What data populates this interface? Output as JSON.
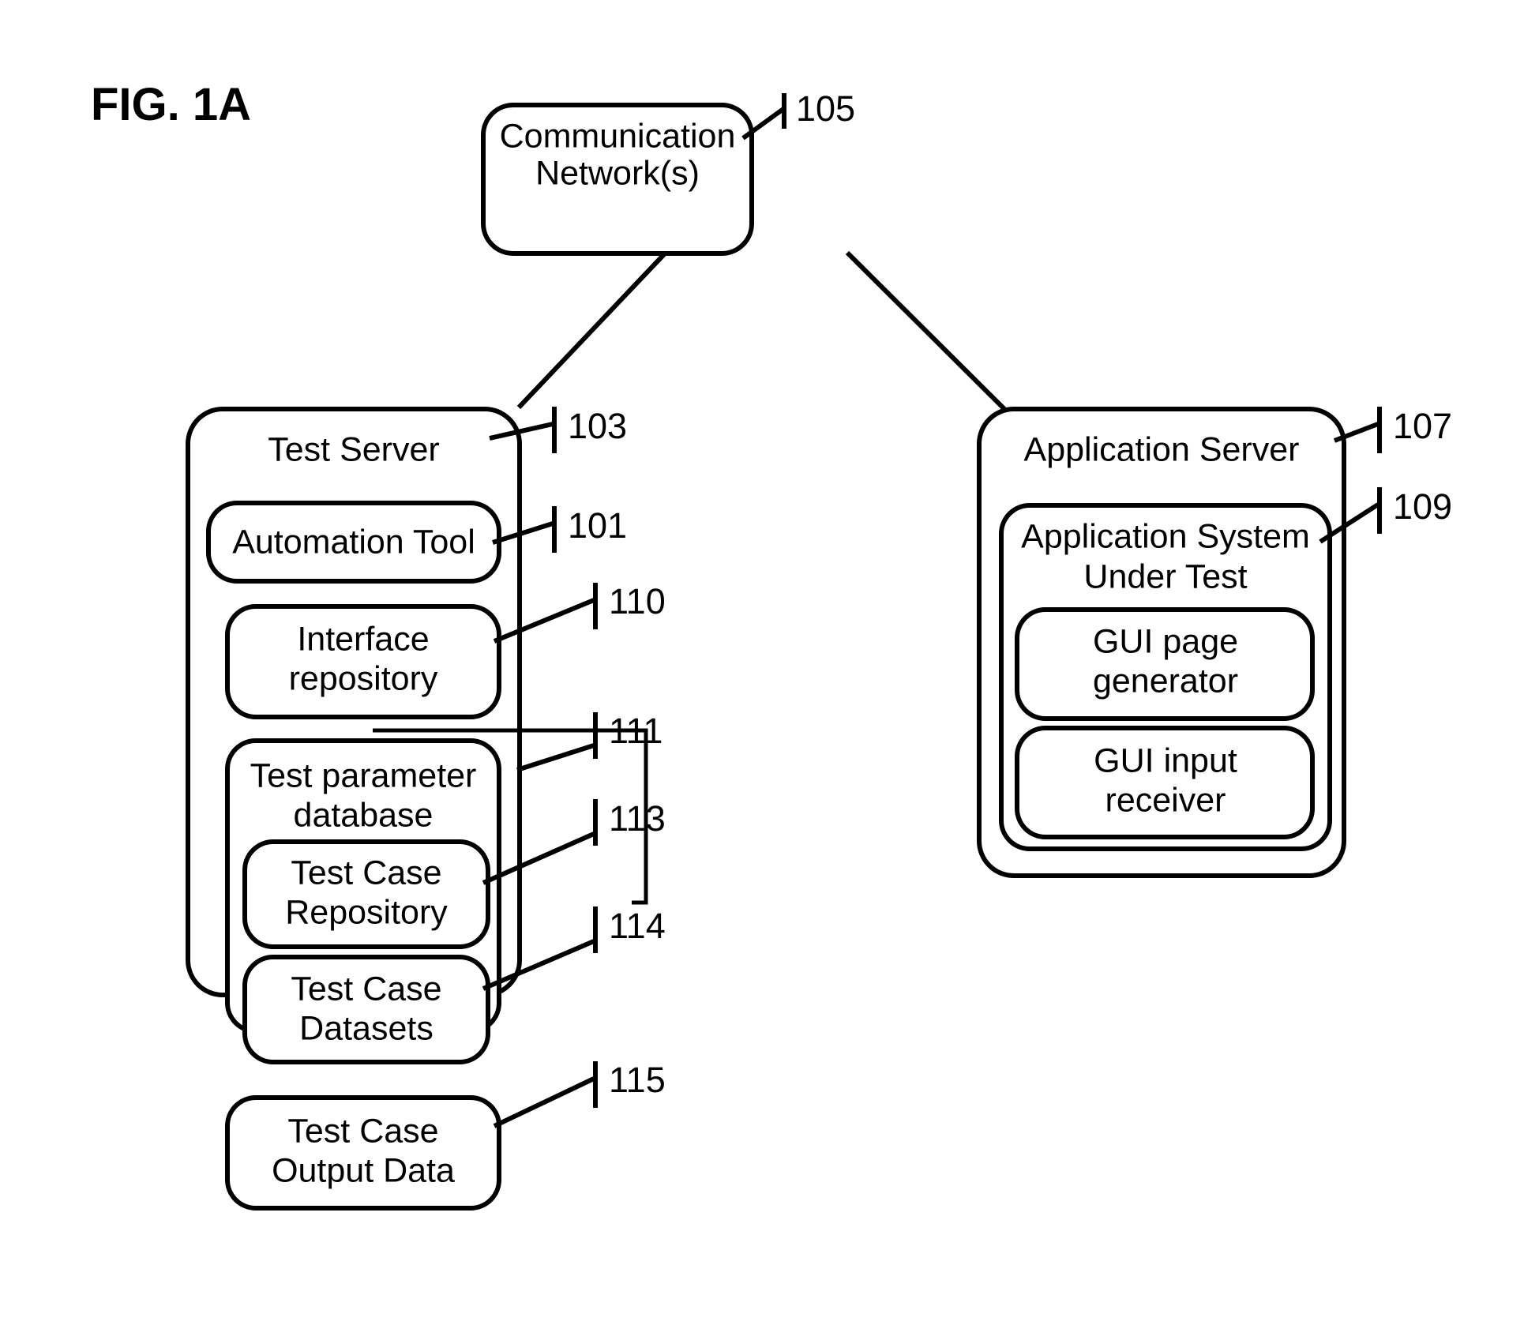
{
  "figure": {
    "title": "FIG. 1A",
    "line_color": "#000000",
    "background_color": "#ffffff"
  },
  "nodes": {
    "communication_network": {
      "label_line1": "Communication",
      "label_line2": "Network(s)",
      "ref": "105"
    },
    "test_server": {
      "label": "Test Server",
      "ref": "103"
    },
    "automation_tool": {
      "label": "Automation Tool",
      "ref": "101"
    },
    "interface_repository": {
      "label_line1": "Interface",
      "label_line2": "repository",
      "ref": "110"
    },
    "test_parameter_database": {
      "label_line1": "Test parameter",
      "label_line2": "database",
      "ref": "111"
    },
    "test_case_repository": {
      "label_line1": "Test Case",
      "label_line2": "Repository",
      "ref": "113"
    },
    "test_case_datasets": {
      "label_line1": "Test Case",
      "label_line2": "Datasets",
      "ref": "114"
    },
    "test_case_output_data": {
      "label_line1": "Test Case",
      "label_line2": "Output Data",
      "ref": "115"
    },
    "application_server": {
      "label": "Application Server",
      "ref": "107"
    },
    "application_system_under_test": {
      "label_line1": "Application System",
      "label_line2": "Under Test",
      "ref": "109"
    },
    "gui_page_generator": {
      "label_line1": "GUI page",
      "label_line2": "generator"
    },
    "gui_input_receiver": {
      "label_line1": "GUI input",
      "label_line2": "receiver"
    }
  },
  "connections": [
    {
      "from": "communication_network",
      "to": "test_server"
    },
    {
      "from": "communication_network",
      "to": "application_server"
    }
  ]
}
